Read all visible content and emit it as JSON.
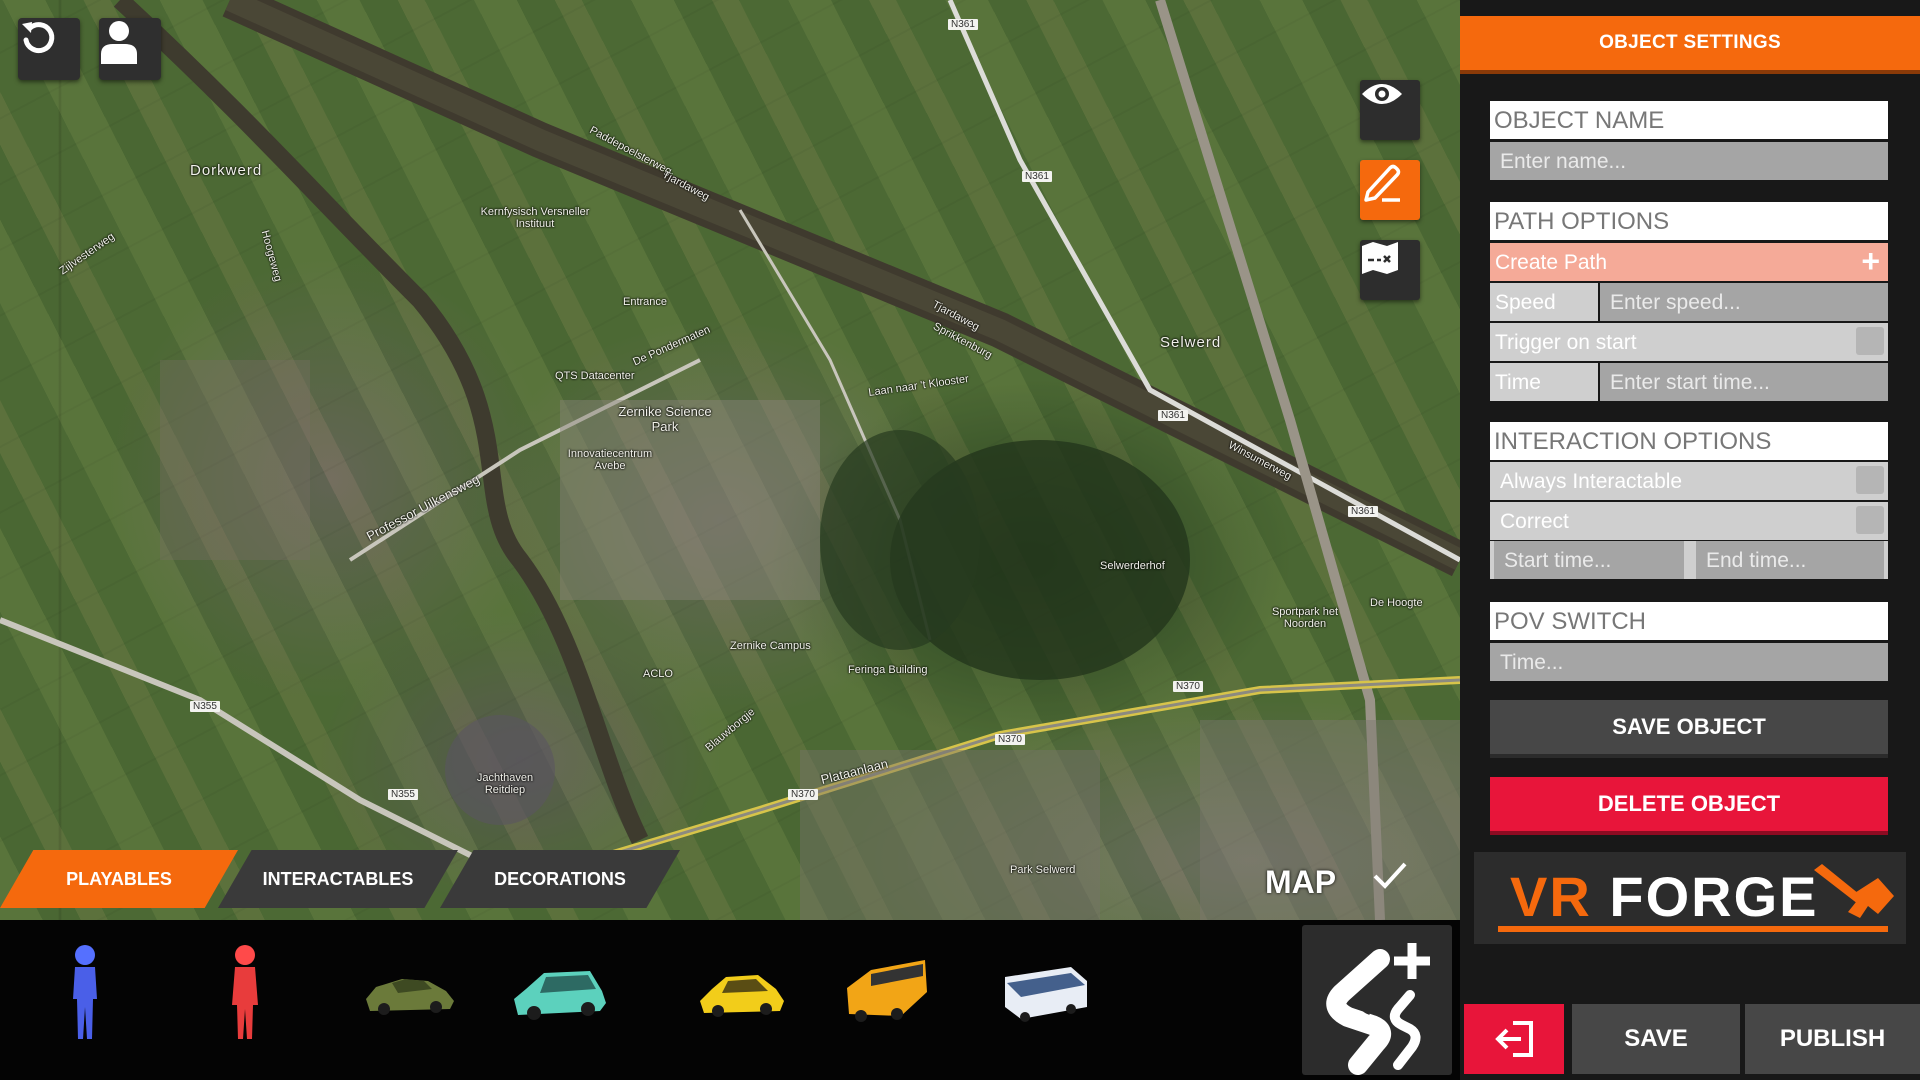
{
  "map": {
    "title": "MAP",
    "labels": {
      "dorkwerd": "Dorkwerd",
      "selwerd": "Selwerd",
      "paddepoelsterweg": "Paddepoelsterweg",
      "tjardaweg": "Tjardaweg",
      "sprikkenburg": "Sprikkenburg",
      "zernike_park": "Zernike Science Park",
      "zernike_campus": "Zernike Campus",
      "kvi": "Kernfysisch Versneller Instituut",
      "professor": "Professor Uilkensweg",
      "selwerderhof": "Selwerderhof",
      "sportpark": "Sportpark het Noorden",
      "park_selwerd": "Park Selwerd",
      "jachthaven": "Jachthaven Reitdiep",
      "plataanlaan": "Plataanlaan",
      "blauwborgje": "Blauwborgje",
      "aclo": "ACLO",
      "feringa": "Feringa Building",
      "winsumerweg": "Winsumerweg",
      "de_hoogte": "De Hoogte",
      "zijlvesterweg": "Zijlvesterweg",
      "hoogeweg": "Hoogeweg",
      "n361": "N361",
      "n370": "N370",
      "n355": "N355",
      "qts": "QTS Datacenter",
      "entrance": "Entrance",
      "innovatie": "Innovatiecentrum Avebe",
      "pondermaten": "De Pondermaten",
      "laan": "Laan naar 't Klooster"
    }
  },
  "tabs": [
    {
      "label": "PLAYABLES",
      "active": true
    },
    {
      "label": "INTERACTABLES",
      "active": false
    },
    {
      "label": "DECORATIONS",
      "active": false
    }
  ],
  "items": [
    {
      "name": "blue-person"
    },
    {
      "name": "red-person"
    },
    {
      "name": "green-sedan"
    },
    {
      "name": "teal-wagon"
    },
    {
      "name": "yellow-taxi"
    },
    {
      "name": "school-bus"
    },
    {
      "name": "coach-bus"
    }
  ],
  "panel": {
    "header": "OBJECT SETTINGS",
    "object_name": {
      "title": "OBJECT NAME",
      "placeholder": "Enter name..."
    },
    "path_options": {
      "title": "PATH OPTIONS",
      "create_path": "Create Path",
      "speed_label": "Speed",
      "speed_placeholder": "Enter speed...",
      "trigger_label": "Trigger on start",
      "time_label": "Time",
      "time_placeholder": "Enter start time..."
    },
    "interaction_options": {
      "title": "INTERACTION OPTIONS",
      "always_label": "Always Interactable",
      "correct_label": "Correct",
      "start_placeholder": "Start time...",
      "end_placeholder": "End time..."
    },
    "pov_switch": {
      "title": "POV SWITCH",
      "placeholder": "Time..."
    },
    "save_object": "SAVE OBJECT",
    "delete_object": "DELETE OBJECT",
    "logo": {
      "vr": "VR",
      "forge": "FORGE"
    },
    "save": "SAVE",
    "publish": "PUBLISH"
  },
  "colors": {
    "accent": "#f5690d",
    "danger": "#e8153a",
    "panel": "#181818"
  }
}
